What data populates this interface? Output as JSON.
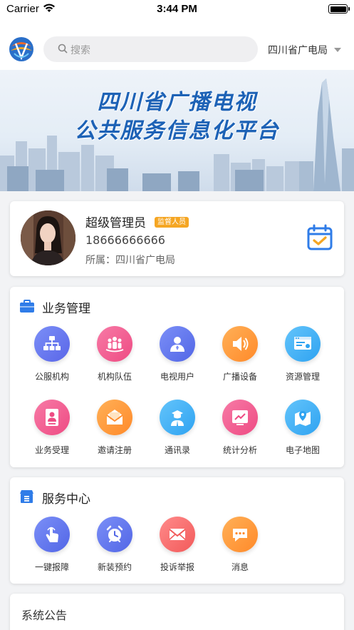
{
  "status_bar": {
    "carrier": "Carrier",
    "time": "3:44 PM"
  },
  "header": {
    "search_placeholder": "搜索",
    "region": "四川省广电局"
  },
  "banner": {
    "line1": "四川省广播电视",
    "line2": "公共服务信息化平台"
  },
  "profile": {
    "name": "超级管理员",
    "badge": "监督人员",
    "phone": "18666666666",
    "org_label": "所属：四川省广电局"
  },
  "business": {
    "title": "业务管理",
    "items": [
      {
        "label": "公服机构",
        "icon": "org-chart-icon",
        "color_from": "#7b8ff7",
        "color_to": "#5a66e8"
      },
      {
        "label": "机构队伍",
        "icon": "team-icon",
        "color_from": "#f77aa6",
        "color_to": "#ee4b83"
      },
      {
        "label": "电视用户",
        "icon": "user-icon",
        "color_from": "#7b8ff7",
        "color_to": "#5266e6"
      },
      {
        "label": "广播设备",
        "icon": "speaker-icon",
        "color_from": "#ffb057",
        "color_to": "#ff8a2a"
      },
      {
        "label": "资源管理",
        "icon": "resource-icon",
        "color_from": "#63c4fb",
        "color_to": "#2fa3f1"
      },
      {
        "label": "业务受理",
        "icon": "document-user-icon",
        "color_from": "#f77aa6",
        "color_to": "#ee4b83"
      },
      {
        "label": "邀请注册",
        "icon": "envelope-open-icon",
        "color_from": "#ffb057",
        "color_to": "#ff8a2a"
      },
      {
        "label": "通讯录",
        "icon": "contact-icon",
        "color_from": "#63c4fb",
        "color_to": "#2fa3f1"
      },
      {
        "label": "统计分析",
        "icon": "chart-icon",
        "color_from": "#f77aa6",
        "color_to": "#ee4b83"
      },
      {
        "label": "电子地图",
        "icon": "map-icon",
        "color_from": "#63c4fb",
        "color_to": "#2fa3f1"
      }
    ]
  },
  "service": {
    "title": "服务中心",
    "items": [
      {
        "label": "一键报障",
        "icon": "tap-icon",
        "color_from": "#7b8ff7",
        "color_to": "#5266e6"
      },
      {
        "label": "新装预约",
        "icon": "alarm-clock-icon",
        "color_from": "#7b8ff7",
        "color_to": "#5266e6"
      },
      {
        "label": "投诉举报",
        "icon": "mail-icon",
        "color_from": "#ff8a8a",
        "color_to": "#f25a5a"
      },
      {
        "label": "消息",
        "icon": "chat-icon",
        "color_from": "#ffb057",
        "color_to": "#ff8a2a"
      }
    ]
  },
  "notice": {
    "title": "系统公告"
  }
}
